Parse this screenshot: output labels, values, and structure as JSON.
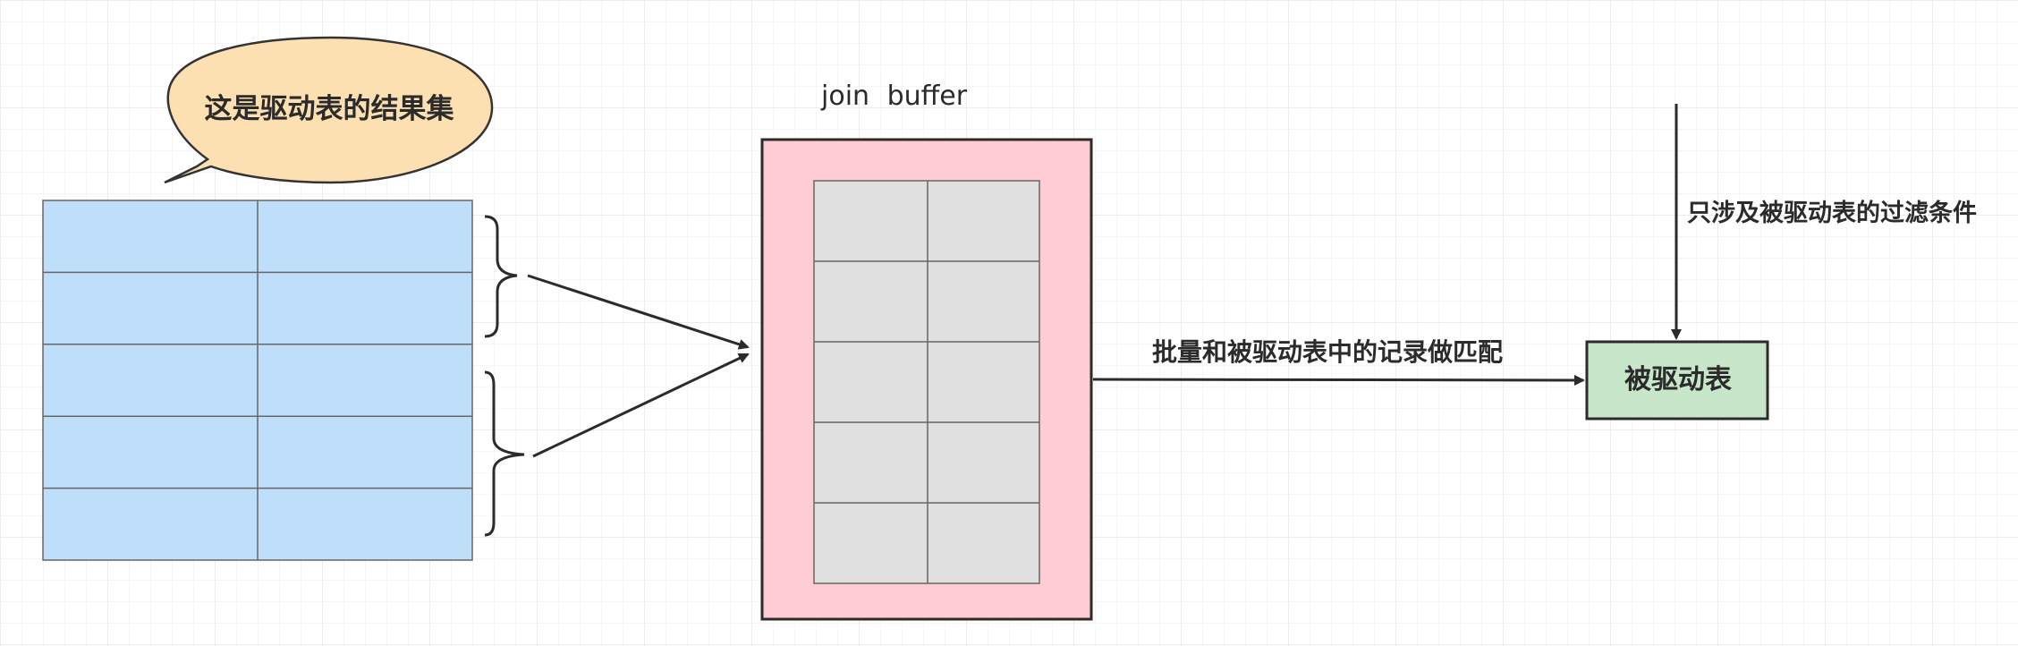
{
  "bubble": {
    "text": "这是驱动表的结果集",
    "fill": "#fde0b2",
    "stroke": "#333333"
  },
  "driving_table": {
    "rows": 5,
    "cols": 2,
    "fill": "#bfdefa",
    "stroke": "#666666"
  },
  "join_buffer": {
    "title": "join  buffer",
    "outer_fill": "#ffccd3",
    "inner_fill": "#e0e0e0",
    "stroke": "#2b2b2b",
    "rows": 5,
    "cols": 2
  },
  "arrows": {
    "match_label": "批量和被驱动表中的记录做匹配",
    "filter_label": "只涉及被驱动表的过滤条件",
    "color": "#2b2b2b"
  },
  "driven_table": {
    "label": "被驱动表",
    "fill": "#c8e6c9",
    "stroke": "#2b2b2b"
  }
}
